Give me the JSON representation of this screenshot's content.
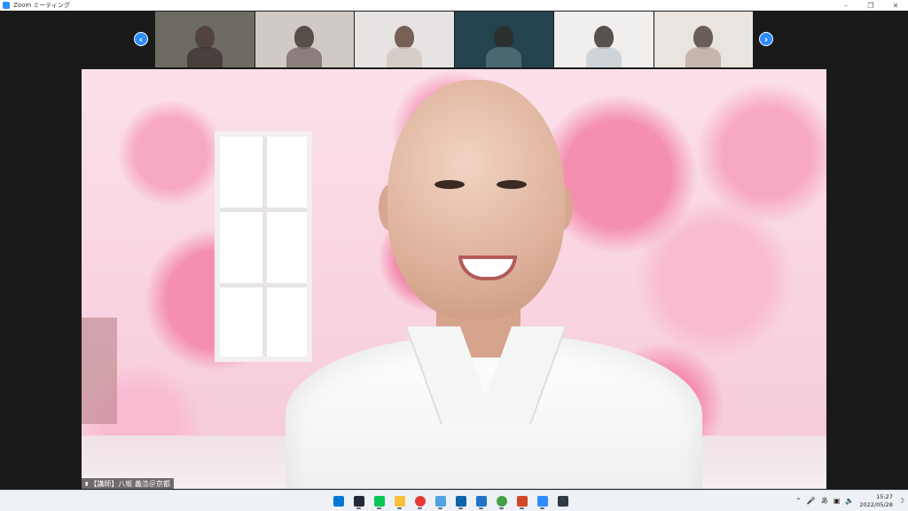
{
  "window": {
    "title": "Zoom ミーティング",
    "controls": [
      "minimize",
      "restore",
      "close"
    ]
  },
  "gallery": {
    "prev_icon": "chevron-left-icon",
    "next_icon": "chevron-right-icon",
    "participants_visible": 6
  },
  "active_speaker": {
    "name_label": "【講師】八坂 義浩＠京都"
  },
  "taskbar": {
    "apps": [
      {
        "name": "windows-start",
        "color": "#0078d4"
      },
      {
        "name": "app-terminal",
        "color": "#1f2a36"
      },
      {
        "name": "line",
        "color": "#06c755"
      },
      {
        "name": "file-explorer",
        "color": "#f8c13a"
      },
      {
        "name": "chrome",
        "color": "#e53935"
      },
      {
        "name": "notepad",
        "color": "#4fa3e0"
      },
      {
        "name": "outlook",
        "color": "#0a64ad"
      },
      {
        "name": "remote-desktop",
        "color": "#2173c9"
      },
      {
        "name": "chrome-profile",
        "color": "#43a047"
      },
      {
        "name": "powerpoint",
        "color": "#d24726"
      },
      {
        "name": "zoom",
        "color": "#2d8cff"
      },
      {
        "name": "app-dark",
        "color": "#2e3b46"
      }
    ],
    "tray": {
      "ime": "あ",
      "time": "15:27",
      "date": "2022/05/28"
    }
  },
  "colors": {
    "zoom_blue": "#2d8cff",
    "stage_bg": "#1a1a1a"
  }
}
